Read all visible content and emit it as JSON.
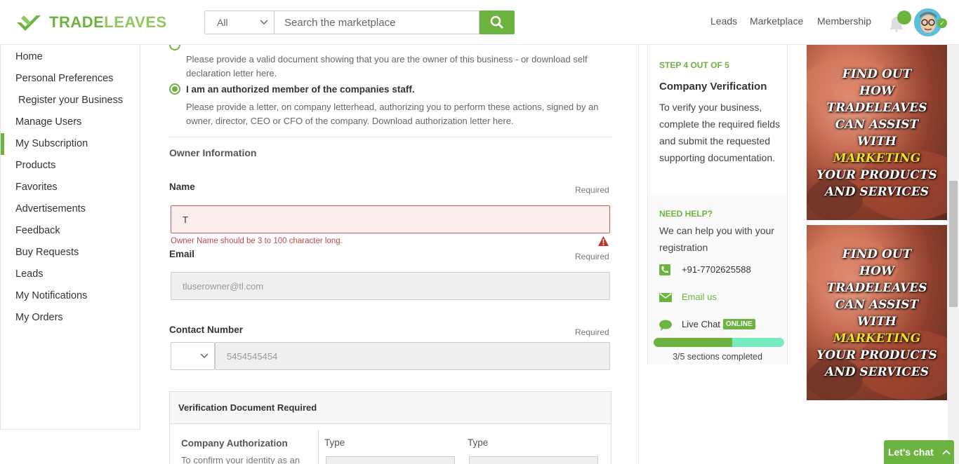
{
  "brand": {
    "logo_text_a": "TRADE",
    "logo_text_b": "LEAVES"
  },
  "search": {
    "category": "All",
    "placeholder": "Search the marketplace"
  },
  "topnav": {
    "leads": "Leads",
    "marketplace": "Marketplace",
    "membership": "Membership"
  },
  "sidebar": {
    "items": [
      "Home",
      "Personal Preferences",
      "Register your Business",
      "Manage Users",
      "My Subscription",
      "Products",
      "Favorites",
      "Advertisements",
      "Feedback",
      "Buy Requests",
      "Leads",
      "My Notifications",
      "My Orders"
    ],
    "active": "Register your Business"
  },
  "form": {
    "owner_doc_text": "Please provide a valid document showing that you are the owner of this business - or download self declaration letter here.",
    "staff_option": "I am an authorized member of the companies staff.",
    "staff_doc_text": "Please provide a letter, on company letterhead, authorizing you to perform these actions, signed by an owner, director, CEO or CFO of the company. Download authorization letter here.",
    "section_title": "Owner Information",
    "required": "Required",
    "name_label": "Name",
    "name_value": "T",
    "name_error": "Owner Name should be 3 to 100 character long.",
    "email_label": "Email",
    "email_value": "tluserowner@tl.com",
    "contact_label": "Contact Number",
    "contact_value": "5454545454",
    "doc_box_title": "Verification Document Required",
    "company_auth": "Company Authorization",
    "company_auth_desc": "To confirm your identity as an",
    "type_label": "Type"
  },
  "steps": {
    "step": "STEP 4 OUT OF 5",
    "title": "Company Verification",
    "desc": "To verify your business, complete the required fields and submit the requested supporting documentation.",
    "help_title": "NEED HELP?",
    "help_desc": "We can help you with your registration",
    "phone": "+91-7702625588",
    "email": "Email us",
    "chat": "Live Chat",
    "online": "ONLINE",
    "progress_fraction": 0.6,
    "progress_text": "3/5 sections completed"
  },
  "ads": {
    "line1": "FIND OUT",
    "line2": "HOW",
    "line3": "TRADELEAVES",
    "line4": "CAN ASSIST",
    "line5": "WITH",
    "highlight": "MARKETING",
    "line6": "YOUR PRODUCTS",
    "line7": "AND SERVICES"
  },
  "chat_button": "Let's chat",
  "colors": {
    "brand_green": "#6cb33f",
    "error_red": "#b94a48",
    "progress_light": "#77ecc1"
  }
}
